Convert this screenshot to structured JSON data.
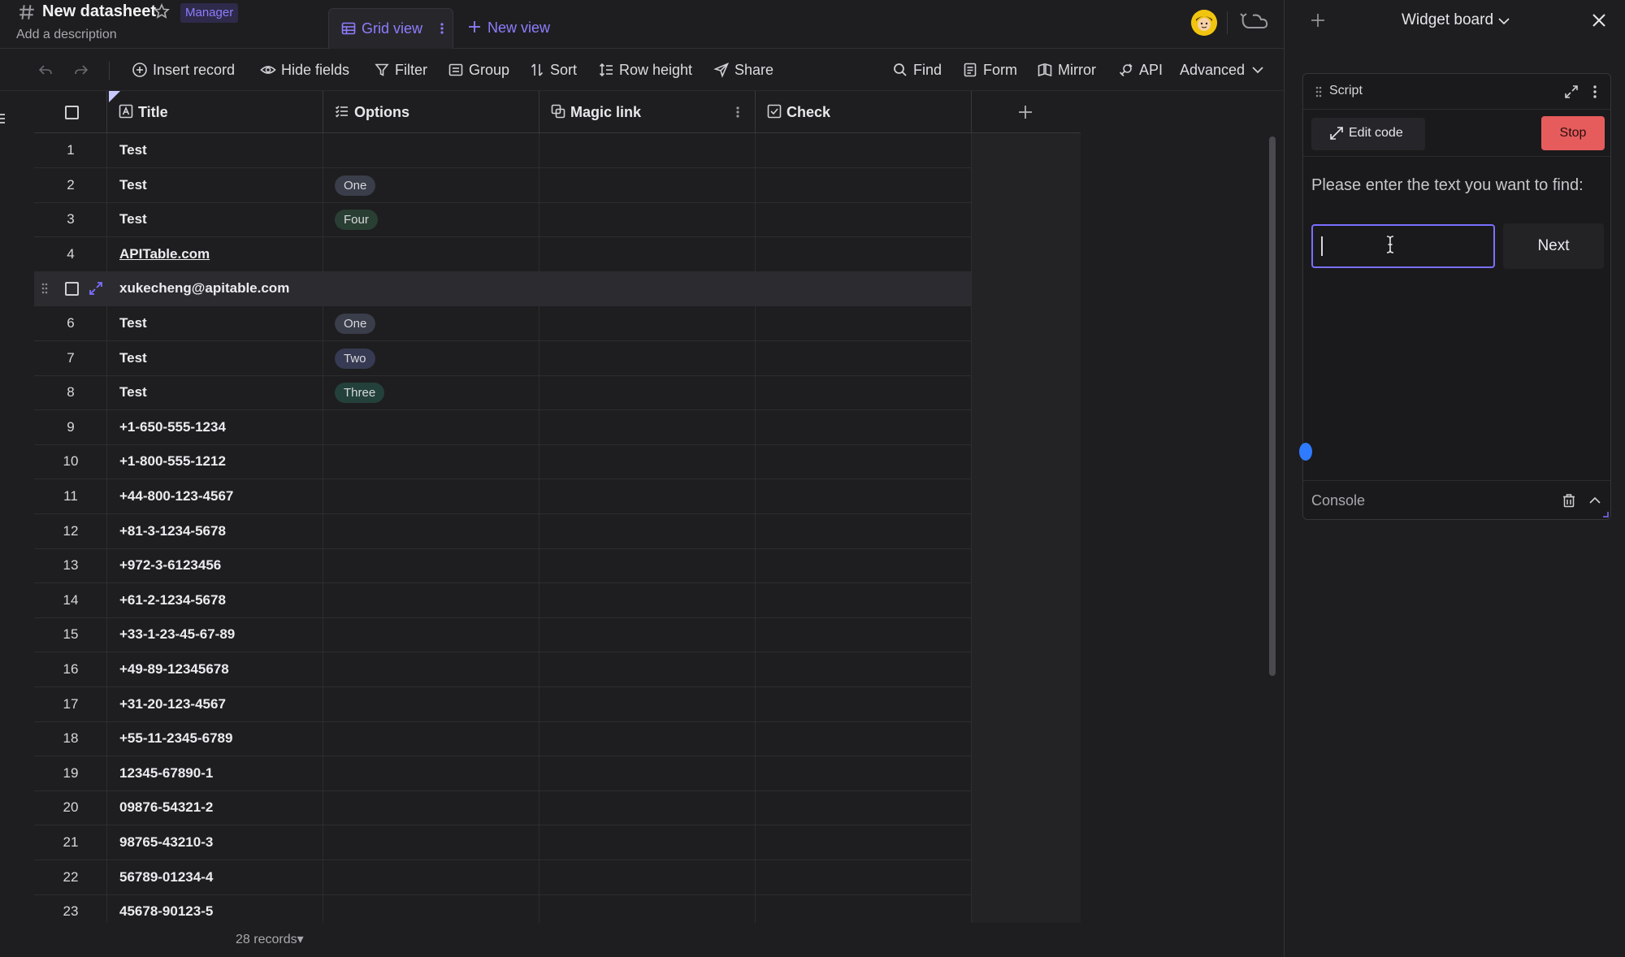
{
  "header": {
    "title": "New datasheet",
    "role": "Manager",
    "description": "Add a description",
    "active_view": "Grid view",
    "new_view": "New view"
  },
  "toolbar": {
    "insert_record": "Insert record",
    "hide_fields": "Hide fields",
    "filter": "Filter",
    "group": "Group",
    "sort": "Sort",
    "row_height": "Row height",
    "share": "Share",
    "find": "Find",
    "form": "Form",
    "mirror": "Mirror",
    "api": "API",
    "advanced": "Advanced"
  },
  "grid": {
    "columns": [
      {
        "label": "Title",
        "icon": "text-field-icon"
      },
      {
        "label": "Options",
        "icon": "multi-select-icon"
      },
      {
        "label": "Magic link",
        "icon": "link-icon"
      },
      {
        "label": "Check",
        "icon": "checkbox-icon"
      }
    ],
    "rows": [
      {
        "num": "1",
        "title": "Test",
        "option": ""
      },
      {
        "num": "2",
        "title": "Test",
        "option": "One"
      },
      {
        "num": "3",
        "title": "Test",
        "option": "Four"
      },
      {
        "num": "4",
        "title": "APITable.com",
        "option": ""
      },
      {
        "num": "",
        "title": "xukecheng@apitable.com",
        "option": ""
      },
      {
        "num": "6",
        "title": "Test",
        "option": "One"
      },
      {
        "num": "7",
        "title": "Test",
        "option": "Two"
      },
      {
        "num": "8",
        "title": "Test",
        "option": "Three"
      },
      {
        "num": "9",
        "title": "+1-650-555-1234",
        "option": ""
      },
      {
        "num": "10",
        "title": "+1-800-555-1212",
        "option": ""
      },
      {
        "num": "11",
        "title": "+44-800-123-4567",
        "option": ""
      },
      {
        "num": "12",
        "title": "+81-3-1234-5678",
        "option": ""
      },
      {
        "num": "13",
        "title": "+972-3-6123456",
        "option": ""
      },
      {
        "num": "14",
        "title": "+61-2-1234-5678",
        "option": ""
      },
      {
        "num": "15",
        "title": "+33-1-23-45-67-89",
        "option": ""
      },
      {
        "num": "16",
        "title": "+49-89-12345678",
        "option": ""
      },
      {
        "num": "17",
        "title": "+31-20-123-4567",
        "option": ""
      },
      {
        "num": "18",
        "title": "+55-11-2345-6789",
        "option": ""
      },
      {
        "num": "19",
        "title": "12345-67890-1",
        "option": ""
      },
      {
        "num": "20",
        "title": "09876-54321-2",
        "option": ""
      },
      {
        "num": "21",
        "title": "98765-43210-3",
        "option": ""
      },
      {
        "num": "22",
        "title": "56789-01234-4",
        "option": ""
      },
      {
        "num": "23",
        "title": "45678-90123-5",
        "option": ""
      }
    ],
    "option_colors": {
      "One": "#3a3d4a",
      "Two": "#363a52",
      "Three": "#23413a",
      "Four": "#2a3f33"
    }
  },
  "footer": {
    "records": "28 records▾"
  },
  "widget_board": {
    "title": "Widget board",
    "widget": {
      "name": "Script",
      "edit_code": "Edit code",
      "stop": "Stop",
      "prompt": "Please enter the text you want to find:",
      "input_value": "",
      "next": "Next",
      "console": "Console"
    }
  },
  "colors": {
    "accent": "#7b6fff",
    "stop": "#e65c5c",
    "background": "#1e1e20"
  }
}
